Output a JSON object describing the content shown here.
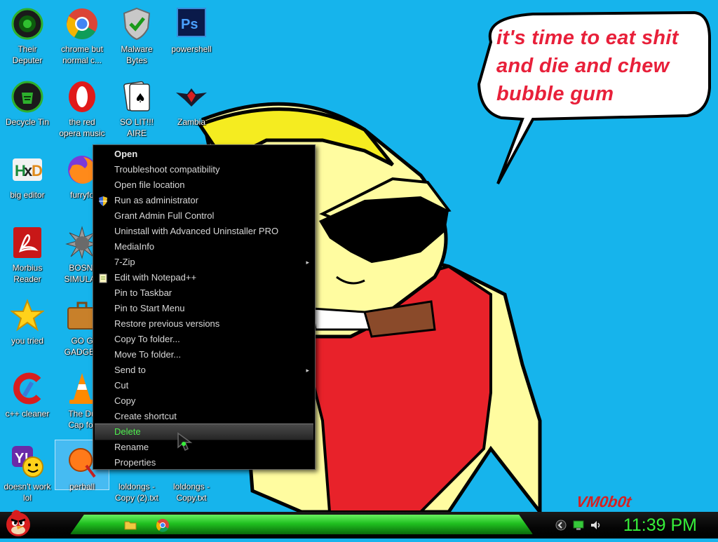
{
  "wallpaper": {
    "speech_bubble": "it's time to eat shit and die and chew bubble gum",
    "signature": "VM0b0t"
  },
  "desktop_icons": [
    {
      "label": "Their\nDeputer",
      "icon": "computer-icon"
    },
    {
      "label": "chrome but\nnormal c...",
      "icon": "chrome-icon"
    },
    {
      "label": "Malware\nBytes",
      "icon": "shield-check-icon"
    },
    {
      "label": "powershell",
      "icon": "photoshop-icon"
    },
    {
      "label": "Decycle Tin",
      "icon": "recycle-bin-icon"
    },
    {
      "label": "the red\nopera music",
      "icon": "opera-icon"
    },
    {
      "label": "SO LIT!!!\nAIRE",
      "icon": "cards-icon"
    },
    {
      "label": "Zambia",
      "icon": "emblem-icon"
    },
    {
      "label": "big editor",
      "icon": "hxd-icon"
    },
    {
      "label": "furryfo",
      "icon": "firefox-icon"
    },
    {
      "label": "Morbius\nReader",
      "icon": "pdf-reader-icon"
    },
    {
      "label": "BOSNI\nSIMULAT",
      "icon": "spiky-ball-icon"
    },
    {
      "label": "you tried",
      "icon": "star-icon"
    },
    {
      "label": "GO G\nGADGET",
      "icon": "briefcase-icon"
    },
    {
      "label": "c++ cleaner",
      "icon": "ccleaner-icon"
    },
    {
      "label": "The Du\nCap for",
      "icon": "vlc-cone-icon"
    },
    {
      "label": "doesn't work\nlol",
      "icon": "yahoo-messenger-icon"
    },
    {
      "label": "perball",
      "icon": "pinball-icon"
    },
    {
      "label": "loldongs -\nCopy (2).txt",
      "icon": "text-file-icon"
    },
    {
      "label": "loldongs -\nCopy.txt",
      "icon": "text-file-icon"
    }
  ],
  "context_menu": {
    "items": [
      {
        "label": "Open",
        "bold": true
      },
      {
        "label": "Troubleshoot compatibility"
      },
      {
        "label": "Open file location"
      },
      {
        "label": "Run as administrator",
        "icon": "uac-shield-icon"
      },
      {
        "label": "Grant Admin Full Control"
      },
      {
        "label": "Uninstall with Advanced Uninstaller PRO"
      },
      {
        "label": "MediaInfo"
      },
      {
        "label": "7-Zip",
        "submenu": true
      },
      {
        "label": "Edit with Notepad++",
        "icon": "notepad-icon"
      },
      {
        "label": "Pin to Taskbar"
      },
      {
        "label": "Pin to Start Menu"
      },
      {
        "label": "Restore previous versions"
      },
      {
        "label": "Copy To folder..."
      },
      {
        "label": "Move To folder..."
      },
      {
        "label": "Send to",
        "submenu": true
      },
      {
        "label": "Cut"
      },
      {
        "label": "Copy"
      },
      {
        "label": "Create shortcut"
      },
      {
        "label": "Delete",
        "highlighted": true
      },
      {
        "label": "Rename"
      },
      {
        "label": "Properties"
      }
    ],
    "submenu_arrow": "▸"
  },
  "taskbar": {
    "start_icon": "angry-bird-icon",
    "pinned": [
      {
        "icon": "folder-icon"
      },
      {
        "icon": "chrome-icon"
      }
    ],
    "tray": [
      {
        "icon": "back-arrow-icon"
      },
      {
        "icon": "monitor-icon"
      },
      {
        "icon": "speaker-icon"
      }
    ],
    "clock": "11:39 PM",
    "accent": "#36f03a"
  }
}
